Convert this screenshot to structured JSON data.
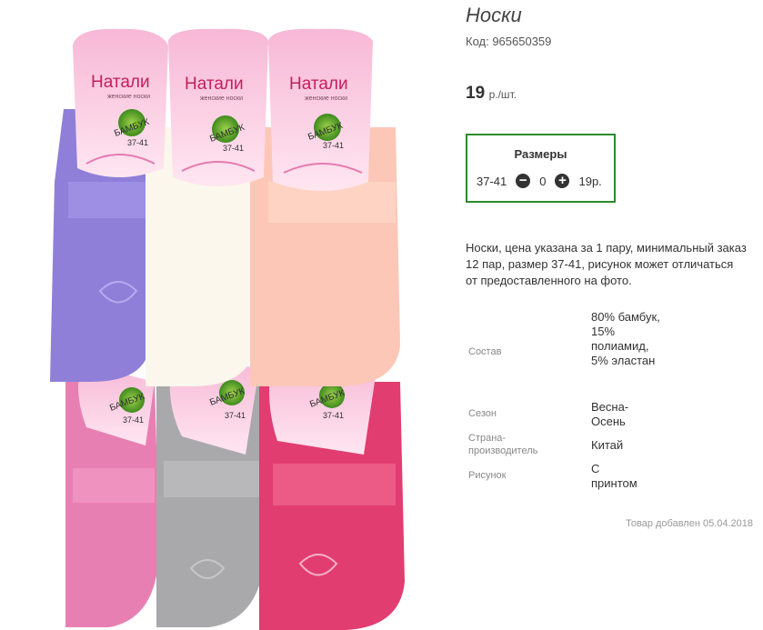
{
  "product": {
    "title": "Носки",
    "code_label": "Код: 965650359",
    "price_value": "19",
    "price_unit": "р./шт."
  },
  "sizes": {
    "heading": "Размеры",
    "size": "37-41",
    "minus_icon": "minus-circle-icon",
    "quantity": "0",
    "plus_icon": "plus-circle-icon",
    "price": "19р.",
    "border_color": "#2c8c2c"
  },
  "description": "Носки, цена указана за 1 пару, минимальный заказ 12 пар, размер 37-41, рисунок может отличаться от предоставленного на фото.",
  "properties": [
    {
      "label": "Состав",
      "value": "80% бамбук, 15% полиамид, 5% эластан"
    },
    {
      "label": "Сезон",
      "value": "Весна-Осень"
    },
    {
      "label": "Страна-производитель",
      "value": "Китай"
    },
    {
      "label": "Рисунок",
      "value": "С принтом"
    }
  ],
  "added": "Товар добавлен 05.04.2018",
  "photo": {
    "brand": "Натали",
    "brand_sub": "женские носки",
    "bamboo": "БАМБУК",
    "size_tag": "37-41",
    "sock_colors": [
      "#8f7fd8",
      "#fbf7ec",
      "#fcc7b6",
      "#e87fb3",
      "#a9a9ab",
      "#e23d70"
    ]
  }
}
